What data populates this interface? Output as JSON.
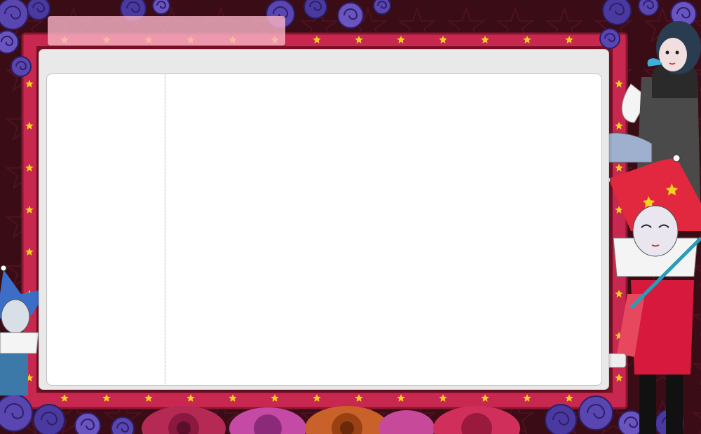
{
  "window": {
    "title": "",
    "left_panel_text": "",
    "right_panel_text": ""
  },
  "colors": {
    "background": "#3a0c16",
    "frame": "#c8284f",
    "frame_dark": "#8c1530",
    "swirl": "#4a3aa0",
    "star": "#f2d21e",
    "title_bar": "#f7b1c3",
    "window": "#e9e9e9",
    "panel": "#ffffff"
  },
  "decorations": {
    "frame_pattern": [
      "star-icon",
      "crescent-moon-icon"
    ],
    "characters": [
      "jester-figure",
      "pierrot-figure",
      "angel-girl-figure"
    ],
    "floor": [
      "flower-icon"
    ]
  }
}
